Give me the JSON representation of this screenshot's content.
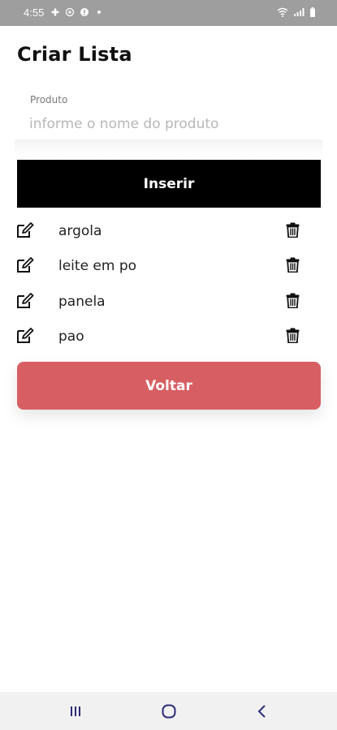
{
  "status_bar": {
    "time": "4:55",
    "left_icons": [
      "fan-icon",
      "vpn-icon",
      "notification-icon",
      "dot-icon"
    ],
    "right_icons": [
      "wifi-icon",
      "signal-icon",
      "battery-icon"
    ]
  },
  "header": {
    "title": "Criar Lista"
  },
  "form": {
    "label": "Produto",
    "value": "",
    "placeholder": "informe o nome do produto",
    "insert_label": "Inserir"
  },
  "items": [
    {
      "name": "argola"
    },
    {
      "name": "leite em po"
    },
    {
      "name": "panela"
    },
    {
      "name": "pao"
    }
  ],
  "back_label": "Voltar",
  "colors": {
    "insert_bg": "#000000",
    "back_bg": "#d75f63",
    "status_bg": "#9e9e9e",
    "nav_icon": "#2c2c7a"
  },
  "nav_bar": {
    "icons": [
      "recent-apps-icon",
      "home-icon",
      "back-icon"
    ]
  }
}
